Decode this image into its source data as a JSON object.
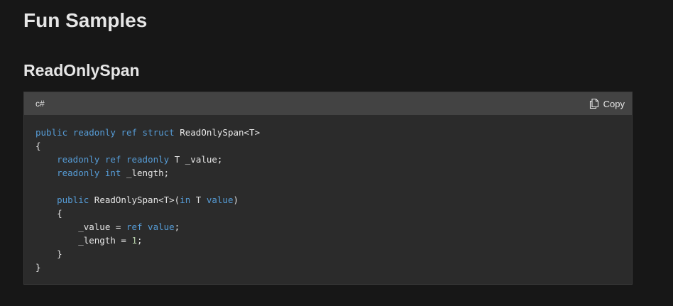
{
  "page": {
    "title": "Fun Samples",
    "section_title": "ReadOnlySpan"
  },
  "code_block": {
    "language": "c#",
    "copy_label": "Copy",
    "copy_icon": "copy-icon",
    "colors": {
      "keyword": "#569cd6",
      "number": "#b5cea8",
      "text": "#e6e6e6"
    },
    "lines": [
      [
        {
          "t": "public",
          "k": "kw"
        },
        {
          "t": " "
        },
        {
          "t": "readonly",
          "k": "kw"
        },
        {
          "t": " "
        },
        {
          "t": "ref",
          "k": "kw"
        },
        {
          "t": " "
        },
        {
          "t": "struct",
          "k": "kw"
        },
        {
          "t": " ReadOnlySpan<T>"
        }
      ],
      [
        {
          "t": "{"
        }
      ],
      [
        {
          "t": "    "
        },
        {
          "t": "readonly",
          "k": "kw"
        },
        {
          "t": " "
        },
        {
          "t": "ref",
          "k": "kw"
        },
        {
          "t": " "
        },
        {
          "t": "readonly",
          "k": "kw"
        },
        {
          "t": " T _value;"
        }
      ],
      [
        {
          "t": "    "
        },
        {
          "t": "readonly",
          "k": "kw"
        },
        {
          "t": " "
        },
        {
          "t": "int",
          "k": "kw"
        },
        {
          "t": " _length;"
        }
      ],
      [
        {
          "t": ""
        }
      ],
      [
        {
          "t": "    "
        },
        {
          "t": "public",
          "k": "kw"
        },
        {
          "t": " ReadOnlySpan<T>("
        },
        {
          "t": "in",
          "k": "kw"
        },
        {
          "t": " T "
        },
        {
          "t": "value",
          "k": "kw"
        },
        {
          "t": ")"
        }
      ],
      [
        {
          "t": "    {"
        }
      ],
      [
        {
          "t": "        _value = "
        },
        {
          "t": "ref",
          "k": "kw"
        },
        {
          "t": " "
        },
        {
          "t": "value",
          "k": "kw"
        },
        {
          "t": ";"
        }
      ],
      [
        {
          "t": "        _length = "
        },
        {
          "t": "1",
          "k": "num"
        },
        {
          "t": ";"
        }
      ],
      [
        {
          "t": "    }"
        }
      ],
      [
        {
          "t": "}"
        }
      ]
    ]
  }
}
